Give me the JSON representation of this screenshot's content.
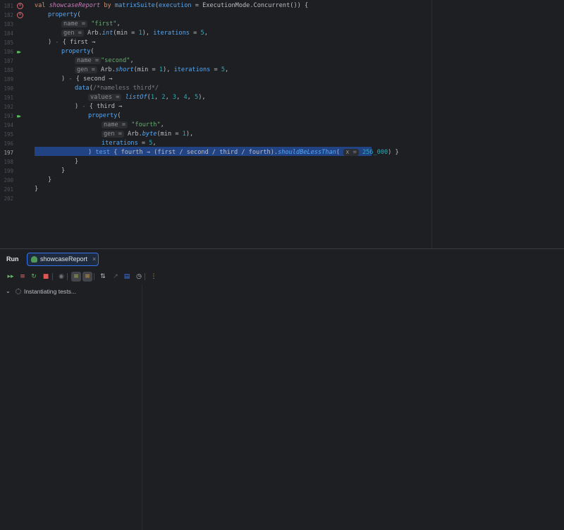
{
  "editor": {
    "gutter": {
      "line_numbers": [
        "181",
        "182",
        "183",
        "184",
        "185",
        "186",
        "187",
        "188",
        "189",
        "190",
        "191",
        "192",
        "193",
        "194",
        "195",
        "196",
        "197",
        "198",
        "199",
        "200",
        "201",
        "202"
      ],
      "current_line": "197",
      "error_icon": "error-circle-icon",
      "run_icon": "run-tests-icon"
    },
    "code": {
      "val": "val",
      "showcaseReport": "showcaseReport",
      "by": "by",
      "matrixSuite": "matrixSuite",
      "execution_param": "execution",
      "execution_value": " = ExecutionMode.Concurrent()) {",
      "property": "property",
      "open_paren": "(",
      "name_hint": "name =",
      "gen_hint": "gen =",
      "values_hint": "values =",
      "x_hint": "x =",
      "first_str": "\"first\"",
      "second_str": "\"second\"",
      "fourth_str": "\"fourth\"",
      "comma": ",",
      "arb": " Arb.",
      "int": "int",
      "short": "short",
      "byte": "byte",
      "min_part": "(min = ",
      "one": "1",
      "close_comma": "), ",
      "iterations": "iterations",
      "eq": " = ",
      "five": "5",
      "close_paren_comma": "),",
      "close_paren": ") ",
      "dash": "-",
      "first_lambda": " { first →",
      "second_lambda": " { second →",
      "third_lambda": " { third →",
      "data": "data",
      "nameless_comment": "/*nameless third*/",
      "listOf": "listOf",
      "list_args_open": "(",
      "list_n1": "1",
      "list_n2": "2",
      "list_n3": "3",
      "list_n4": "4",
      "list_n5": "5",
      "sep": ", ",
      "list_close": "),",
      "line196_close": ") ",
      "test": "test",
      "fourth_lambda": " { fourth → (first / second / third / fourth).",
      "shouldBeLessThan": "shouldBeLessThan",
      "paren_open": "(",
      "n256": "256_000",
      "paren_close_brace": ") }",
      "brace": "}"
    }
  },
  "run_panel": {
    "title": "Run",
    "tab_label": "showcaseReport",
    "tab_close": "×",
    "toolbar": [
      {
        "name": "rerun-all-icon",
        "glyph": "▸▸",
        "color": "#5fb865"
      },
      {
        "name": "rerun-failed-icon",
        "glyph": "≡",
        "color": "#e06c75"
      },
      {
        "name": "toggle-auto-test-icon",
        "glyph": "↻",
        "color": "#5fb865"
      },
      {
        "name": "stop-icon",
        "glyph": "■",
        "color": "#e05555"
      },
      {
        "name": "show-passed-icon",
        "glyph": "◉",
        "color": "#6f737a"
      },
      {
        "name": "show-ignored-icon",
        "glyph": "≡",
        "color": "#a9b94b"
      },
      {
        "name": "sort-alphabetically-icon",
        "glyph": "≡",
        "color": "#d5a03a"
      },
      {
        "name": "sort-by-duration-icon",
        "glyph": "⇅",
        "color": "#bcbec4"
      },
      {
        "name": "import-tests-icon",
        "glyph": "↗",
        "color": "#5a5d63"
      },
      {
        "name": "export-tests-icon",
        "glyph": "▤",
        "color": "#3574f0"
      },
      {
        "name": "history-icon",
        "glyph": "◷",
        "color": "#bcbec4"
      },
      {
        "name": "more-options-icon",
        "glyph": "⋮",
        "color": "#d5a03a"
      }
    ],
    "tree": {
      "root_label": "Instantiating tests..."
    }
  }
}
